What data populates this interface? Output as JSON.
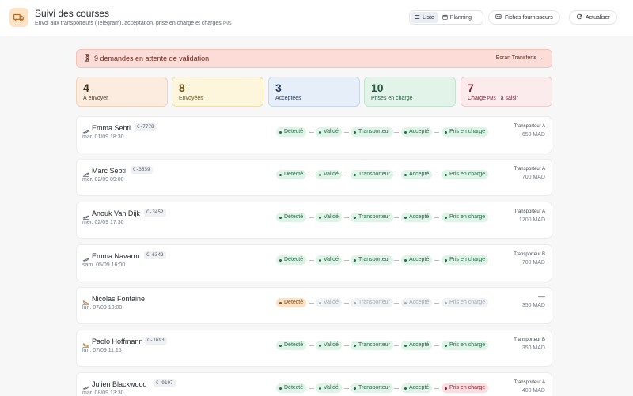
{
  "header": {
    "title": "Suivi des courses",
    "subtitle": "Envoi aux transporteurs (Telegram), acceptation, prise en charge et charges",
    "subtitle_pms": "PMS",
    "view_list": "Liste",
    "view_planning": "Planning",
    "suppliers_button": "Fiches fournisseurs",
    "refresh_button": "Actualiser"
  },
  "alert": {
    "text": "9 demandes en attente de validation",
    "link": "Écran Transferts →"
  },
  "stats": [
    {
      "num": "4",
      "label": "À envoyer",
      "pms": "",
      "suffix": ""
    },
    {
      "num": "8",
      "label": "Envoyées",
      "pms": "",
      "suffix": ""
    },
    {
      "num": "3",
      "label": "Acceptées",
      "pms": "",
      "suffix": ""
    },
    {
      "num": "10",
      "label": "Prises en charge",
      "pms": "",
      "suffix": ""
    },
    {
      "num": "7",
      "label": "Charge",
      "pms": "PMS",
      "suffix": "à saisir"
    }
  ],
  "steps": [
    "Détecté",
    "Validé",
    "Transporteur",
    "Accepté",
    "Pris en charge"
  ],
  "rows": [
    {
      "name": "Emma Sebti",
      "id": "C-7778",
      "date": "mar. 01/09 18:30",
      "carrier": "Transporteur A",
      "price": "650 MAD"
    },
    {
      "name": "Marc Sebti",
      "id": "C-3559",
      "date": "mer. 02/09 09:00",
      "carrier": "Transporteur A",
      "price": "700 MAD"
    },
    {
      "name": "Anouk Van Dijk",
      "id": "C-3452",
      "date": "mer. 02/09 17:30",
      "carrier": "Transporteur A",
      "price": "1200 MAD"
    },
    {
      "name": "Emma Navarro",
      "id": "C-6342",
      "date": "sam. 05/09 16:00",
      "carrier": "Transporteur B",
      "price": "700 MAD"
    },
    {
      "name": "Nicolas Fontaine",
      "id": "",
      "date": "lun. 07/09 10:00",
      "carrier": "—",
      "price": "350 MAD"
    },
    {
      "name": "Paolo Hoffmann",
      "id": "C-1693",
      "date": "lun. 07/09 11:15",
      "carrier": "Transporteur B",
      "price": "350 MAD"
    },
    {
      "name": "Julien Blackwood",
      "id": "C-9197",
      "date": "mar. 08/09 13:30",
      "carrier": "Transporteur A",
      "price": "400 MAD"
    }
  ],
  "colors": {
    "accent": "#1e6b42",
    "alert_bg": "#fbdcd6",
    "pending": "#fbe2c6",
    "danger": "#fbdcdf"
  }
}
